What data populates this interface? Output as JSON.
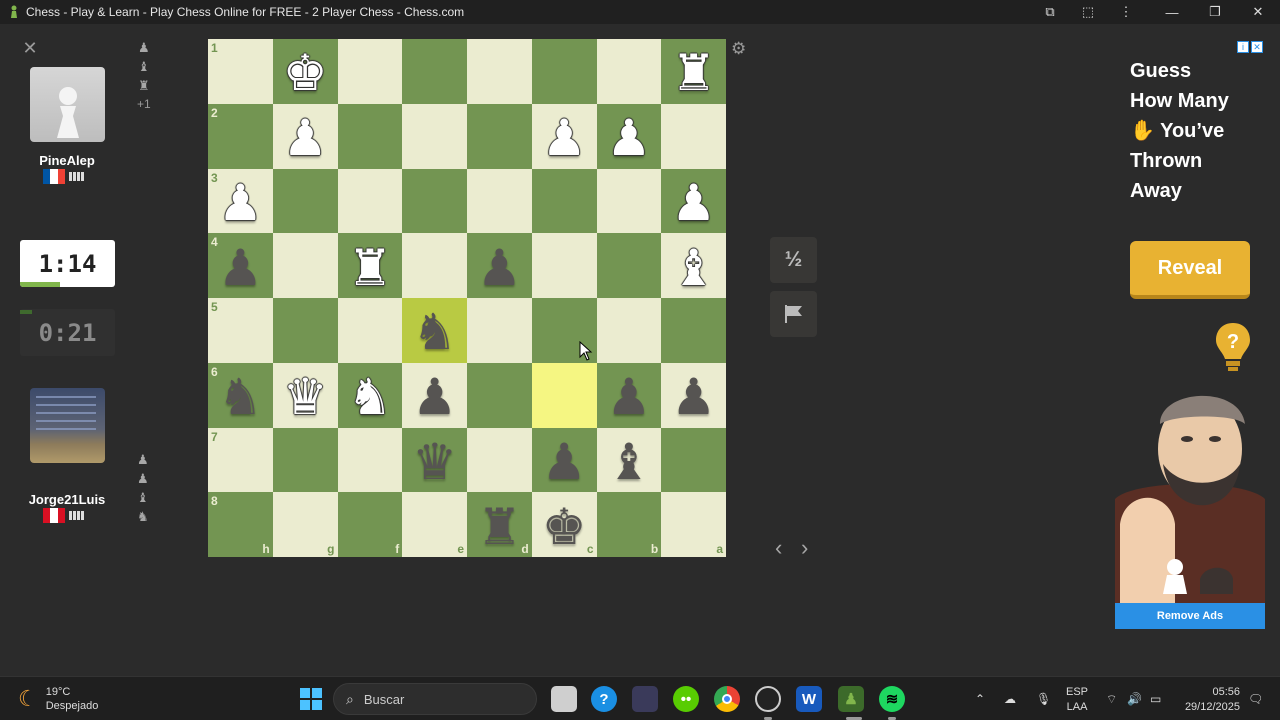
{
  "window": {
    "title": "Chess - Play & Learn - Play Chess Online for FREE - 2 Player Chess - Chess.com"
  },
  "top_player": {
    "name": "PineAlep",
    "flag_colors": [
      "#0055a4",
      "#ffffff",
      "#ef4135"
    ],
    "captured_pieces": [
      "♟",
      "♝",
      "♜"
    ],
    "captured_extra": "+1",
    "clock": "0:21"
  },
  "bottom_player": {
    "name": "Jorge21Luis",
    "flag_colors": [
      "#d91023",
      "#ffffff",
      "#d91023"
    ],
    "captured_pieces": [
      "♟",
      "♟",
      "♝",
      "♞"
    ],
    "clock": "1:14"
  },
  "board": {
    "orientation": "black",
    "rank_labels": [
      "1",
      "2",
      "3",
      "4",
      "5",
      "6",
      "7",
      "8"
    ],
    "file_labels": [
      "h",
      "g",
      "f",
      "e",
      "d",
      "c",
      "b",
      "a"
    ],
    "highlighted_squares": [
      "e5",
      "c6"
    ],
    "rows": [
      [
        "",
        "wK",
        "",
        "",
        "",
        "",
        "",
        "wR"
      ],
      [
        "",
        "wP",
        "",
        "",
        "",
        "wP",
        "wP",
        ""
      ],
      [
        "wP",
        "",
        "",
        "",
        "",
        "",
        "",
        "wP"
      ],
      [
        "bP",
        "",
        "wR",
        "",
        "bP",
        "",
        "",
        "wB"
      ],
      [
        "",
        "",
        "",
        "bN",
        "",
        "",
        "",
        ""
      ],
      [
        "bN",
        "wQ",
        "wN",
        "bP",
        "",
        "",
        "bP",
        "bP"
      ],
      [
        "",
        "",
        "",
        "bQ",
        "",
        "bP",
        "bB",
        ""
      ],
      [
        "",
        "",
        "",
        "",
        "bR",
        "bK",
        "",
        ""
      ]
    ],
    "square_colors": {
      "light": "#ebecd0",
      "dark": "#739552",
      "highlight_light": "#f5f682",
      "highlight_dark": "#b9ca43"
    }
  },
  "controls": {
    "draw_label": "½",
    "resign_icon": "flag-icon",
    "settings_icon": "gear-icon",
    "prev_icon": "chevron-left-icon",
    "next_icon": "chevron-right-icon"
  },
  "ad": {
    "headline_lines": [
      "Guess",
      "How Many",
      "✋ You’ve",
      "Thrown",
      "Away"
    ],
    "button_label": "Reveal",
    "remove_ads_label": "Remove Ads",
    "button_color": "#e8b232",
    "remove_ads_color": "#2a90e5"
  },
  "taskbar": {
    "temperature": "19°C",
    "weather": "Despejado",
    "search_placeholder": "Buscar",
    "language_top": "ESP",
    "language_bottom": "LAA",
    "time": "05:56",
    "date": "29/12/2025"
  }
}
